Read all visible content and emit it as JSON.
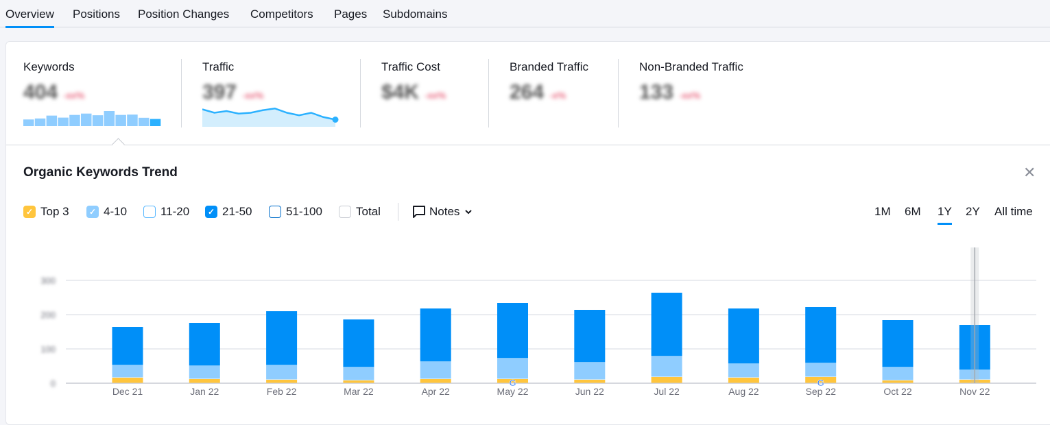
{
  "tabs": [
    {
      "label": "Overview",
      "active": true
    },
    {
      "label": "Positions"
    },
    {
      "label": "Position Changes"
    },
    {
      "label": "Competitors"
    },
    {
      "label": "Pages"
    },
    {
      "label": "Subdomains"
    }
  ],
  "metrics": [
    {
      "label": "Keywords",
      "value": "404",
      "change": "-xx%"
    },
    {
      "label": "Traffic",
      "value": "397",
      "change": "-xx%"
    },
    {
      "label": "Traffic Cost",
      "value": "$4K",
      "change": "-xx%"
    },
    {
      "label": "Branded Traffic",
      "value": "264",
      "change": "-x%"
    },
    {
      "label": "Non-Branded Traffic",
      "value": "133",
      "change": "-xx%"
    }
  ],
  "trend": {
    "title": "Organic Keywords Trend",
    "filters": [
      {
        "label": "Top 3",
        "checked": true,
        "color": "#ffc53d"
      },
      {
        "label": "4-10",
        "checked": true,
        "color": "#8fcdff"
      },
      {
        "label": "11-20",
        "checked": false,
        "color": "#59b8ff"
      },
      {
        "label": "21-50",
        "checked": true,
        "color": "#008ff8"
      },
      {
        "label": "51-100",
        "checked": false,
        "color": "#006dca"
      },
      {
        "label": "Total",
        "checked": false,
        "color": "#c9ccd3"
      }
    ],
    "notes_label": "Notes",
    "ranges": [
      {
        "label": "1M"
      },
      {
        "label": "6M"
      },
      {
        "label": "1Y",
        "active": true
      },
      {
        "label": "2Y"
      },
      {
        "label": "All time"
      }
    ]
  },
  "chart_data": {
    "type": "bar",
    "stacked": true,
    "categories": [
      "Dec 21",
      "Jan 22",
      "Feb 22",
      "Mar 22",
      "Apr 22",
      "May 22",
      "Jun 22",
      "Jul 22",
      "Aug 22",
      "Sep 22",
      "Oct 22",
      "Nov 22"
    ],
    "series": [
      {
        "name": "Top 3",
        "color": "#ffc53d",
        "values": [
          16,
          12,
          10,
          8,
          12,
          12,
          10,
          18,
          16,
          18,
          8,
          10
        ]
      },
      {
        "name": "4-10",
        "color": "#8fcdff",
        "values": [
          36,
          38,
          42,
          38,
          50,
          60,
          50,
          60,
          40,
          40,
          38,
          28
        ]
      },
      {
        "name": "21-50",
        "color": "#008ff8",
        "values": [
          112,
          126,
          158,
          140,
          156,
          162,
          154,
          186,
          162,
          164,
          138,
          132
        ]
      }
    ],
    "yticks": [
      "0",
      "100",
      "200",
      "300"
    ],
    "ylim": [
      0,
      300
    ],
    "grid": true,
    "google_update_markers": [
      "May 22",
      "Sep 22"
    ],
    "sparkline_keywords": [
      164,
      176,
      210,
      186,
      218,
      234,
      214,
      264,
      218,
      222,
      184,
      170
    ],
    "sparkline_traffic": [
      440,
      420,
      430,
      415,
      420,
      435,
      445,
      420,
      405,
      420,
      395,
      380
    ]
  }
}
